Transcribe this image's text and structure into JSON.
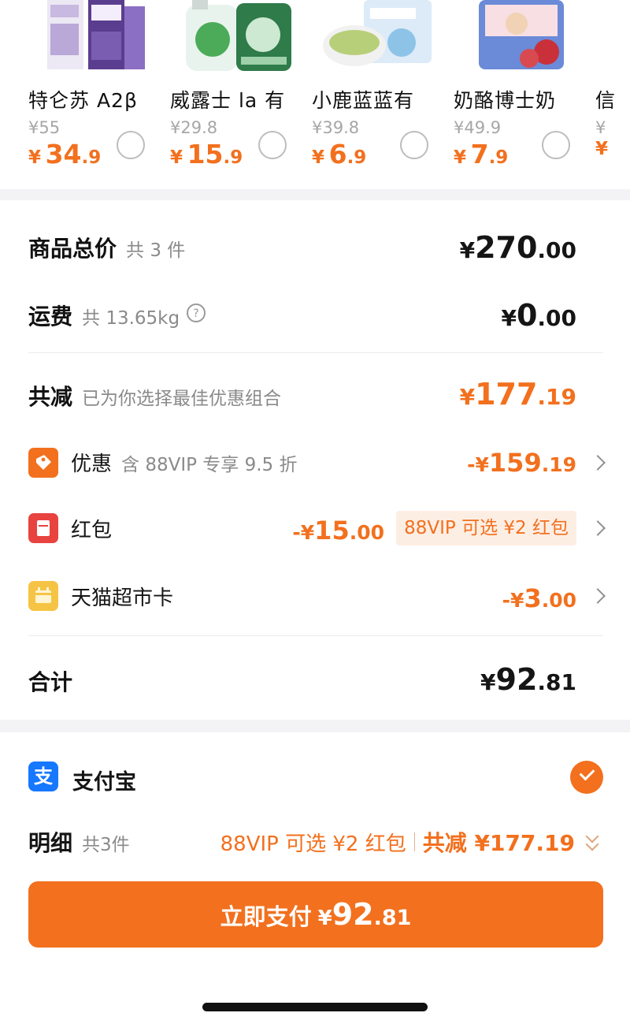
{
  "products": [
    {
      "name": "特仑苏 A2β",
      "original_price": "¥55",
      "sale_currency": "¥",
      "sale_int": "34",
      "sale_dec": ".9",
      "thumb_icon": "milk-box-icon"
    },
    {
      "name": "威露士 la 有",
      "original_price": "¥29.8",
      "sale_currency": "¥",
      "sale_int": "15",
      "sale_dec": ".9",
      "thumb_icon": "detergent-bottle-icon"
    },
    {
      "name": "小鹿蓝蓝有",
      "original_price": "¥39.8",
      "sale_currency": "¥",
      "sale_int": "6",
      "sale_dec": ".9",
      "thumb_icon": "baby-food-icon"
    },
    {
      "name": "奶酪博士奶",
      "original_price": "¥49.9",
      "sale_currency": "¥",
      "sale_int": "7",
      "sale_dec": ".9",
      "thumb_icon": "snack-bag-icon"
    },
    {
      "name": "信",
      "original_price": "¥",
      "sale_currency": "¥",
      "sale_int": "",
      "sale_dec": "",
      "thumb_icon": "product-icon"
    }
  ],
  "summary": {
    "goods_label": "商品总价",
    "goods_sub": "共 3 件",
    "goods_y": "¥",
    "goods_int": "270",
    "goods_dec": ".00",
    "shipping_label": "运费",
    "shipping_sub": "共 13.65kg",
    "shipping_y": "¥",
    "shipping_int": "0",
    "shipping_dec": ".00",
    "reduce_label": "共减",
    "reduce_sub": "已为你选择最佳优惠组合",
    "reduce_y": "¥",
    "reduce_int": "177",
    "reduce_dec": ".19",
    "discounts": {
      "promo_label": "优惠",
      "promo_sub": "含 88VIP 专享 9.5 折",
      "promo_y": "-¥",
      "promo_int": "159",
      "promo_dec": ".19",
      "redpacket_label": "红包",
      "redpacket_y": "-¥",
      "redpacket_int": "15",
      "redpacket_dec": ".00",
      "redpacket_pill": "88VIP 可选 ¥2 红包",
      "card_label": "天猫超市卡",
      "card_y": "-¥",
      "card_int": "3",
      "card_dec": ".00"
    },
    "total_label": "合计",
    "total_y": "¥",
    "total_int": "92",
    "total_dec": ".81"
  },
  "payment": {
    "method_icon_char": "支",
    "method_label": "支付宝",
    "detail_label": "明细",
    "detail_sub": "共3件",
    "detail_option": "88VIP 可选 ¥2 红包",
    "detail_total": "共减 ¥177.19",
    "pay_label": "立即支付",
    "pay_y": "¥",
    "pay_int": "92",
    "pay_dec": ".81"
  },
  "colors": {
    "accent": "#f2701e",
    "alipay": "#1677ff",
    "pill_bg": "#fdeee4"
  }
}
